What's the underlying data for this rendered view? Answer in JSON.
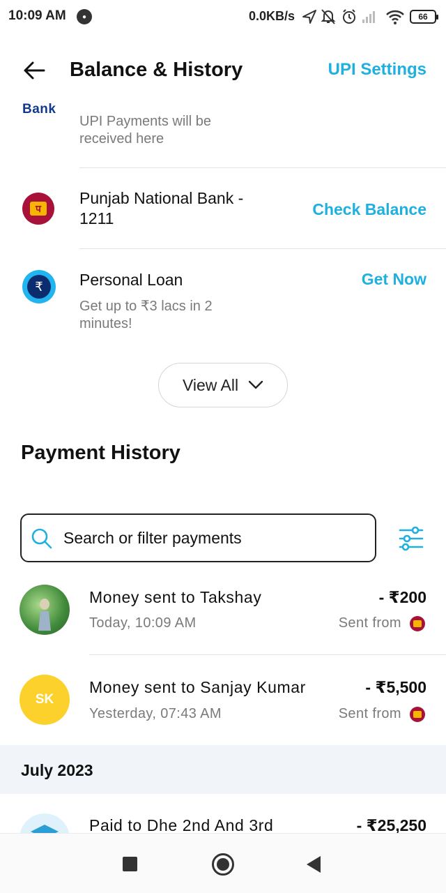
{
  "status_bar": {
    "time": "10:09 AM",
    "network_speed": "0.0KB/s",
    "battery": "66"
  },
  "header": {
    "title": "Balance & History",
    "upi_settings_label": "UPI Settings"
  },
  "accounts": {
    "primary": {
      "logo_text": "Bank",
      "subtitle_line1": "UPI Payments will be",
      "subtitle_line2": "received here"
    },
    "pnb": {
      "name_line1": "Punjab National Bank -",
      "name_line2": "1211",
      "action": "Check Balance"
    },
    "loan": {
      "name": "Personal Loan",
      "subtitle_line1": "Get up to ₹3 lacs in 2",
      "subtitle_line2": "minutes!",
      "action": "Get Now",
      "icon_glyph": "₹"
    },
    "view_all_label": "View All"
  },
  "payment_history": {
    "title": "Payment History",
    "search_placeholder": "Search or filter payments",
    "transactions": [
      {
        "title": "Money sent to Takshay",
        "time": "Today, 10:09 AM",
        "amount": "- ₹200",
        "from_label": "Sent from"
      },
      {
        "initials": "SK",
        "title": "Money sent to Sanjay Kumar",
        "time": "Yesterday, 07:43 AM",
        "amount": "- ₹5,500",
        "from_label": "Sent from"
      }
    ],
    "month_section": "July 2023",
    "month_transactions": [
      {
        "title": "Paid to Dhe 2nd And 3rd",
        "amount": "- ₹25,250"
      }
    ]
  },
  "colors": {
    "accent": "#1fb0e0",
    "pnb_brand": "#a8123a",
    "avatar_yellow": "#fdd12c",
    "month_band": "#f1f4f9"
  }
}
